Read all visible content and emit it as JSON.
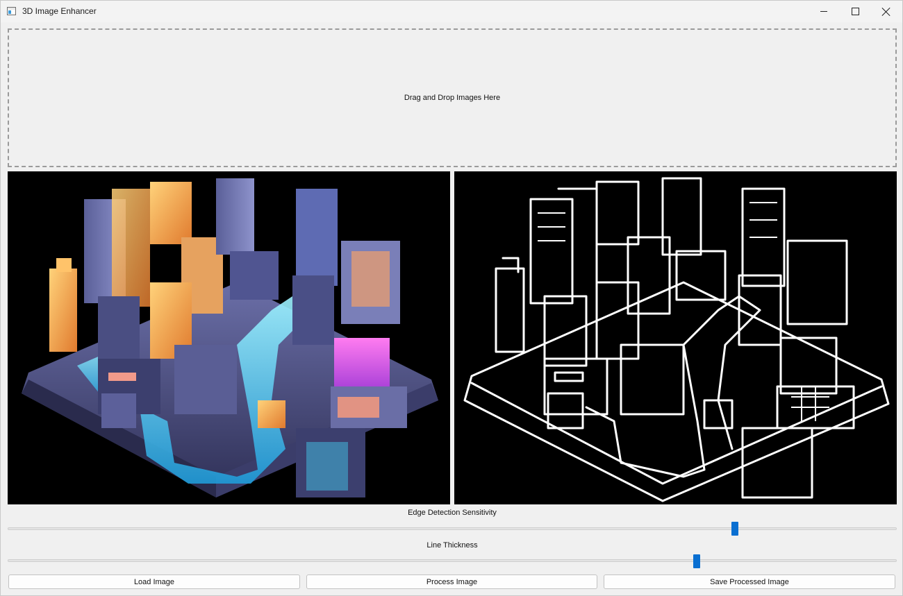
{
  "window": {
    "title": "3D Image Enhancer",
    "icon": "app-window-icon",
    "controls": [
      "minimize-icon",
      "maximize-icon",
      "close-icon"
    ]
  },
  "dropzone": {
    "label": "Drag and Drop Images Here"
  },
  "images": {
    "original": {
      "description_icon": "isometric-city-image"
    },
    "processed": {
      "description_icon": "edge-detected-image"
    }
  },
  "sliders": {
    "edge": {
      "label": "Edge Detection Sensitivity",
      "value_fraction": 0.817
    },
    "thickness": {
      "label": "Line Thickness",
      "value_fraction": 0.775
    }
  },
  "buttons": {
    "load": "Load Image",
    "process": "Process Image",
    "save": "Save Processed Image"
  },
  "colors": {
    "accent": "#0a6fd1",
    "panel_background": "#000000",
    "window_background": "#f0f0f0"
  }
}
